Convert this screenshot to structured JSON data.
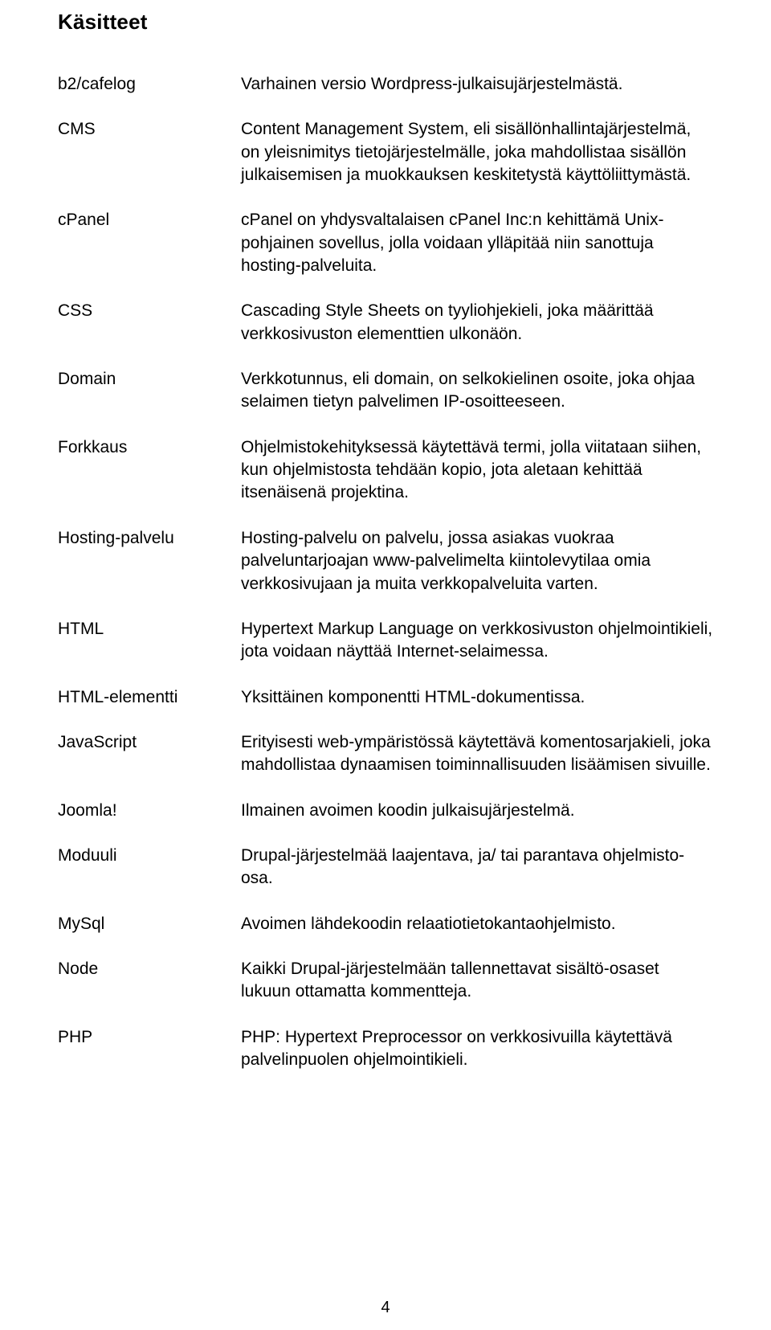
{
  "page": {
    "title": "Käsitteet",
    "number": "4"
  },
  "definitions": [
    {
      "term": "b2/cafelog",
      "def": "Varhainen versio Wordpress-julkaisujärjestelmästä."
    },
    {
      "term": "CMS",
      "def": "Content Management System, eli sisällönhallintajärjestelmä, on yleisnimitys tietojärjestelmälle, joka mahdollistaa sisällön julkaisemisen ja muokkauksen keskitetystä käyttöliittymästä."
    },
    {
      "term": "cPanel",
      "def": "cPanel on yhdysvaltalaisen cPanel Inc:n kehittämä Unix-pohjainen sovellus, jolla voidaan ylläpitää niin sanottuja hosting-palveluita."
    },
    {
      "term": "CSS",
      "def": "Cascading Style Sheets on tyyliohjekieli, joka määrittää verkkosivuston elementtien ulkonäön."
    },
    {
      "term": "Domain",
      "def": "Verkkotunnus, eli domain, on selkokielinen osoite, joka ohjaa selaimen tietyn palvelimen IP-osoitteeseen."
    },
    {
      "term": "Forkkaus",
      "def": "Ohjelmistokehityksessä käytettävä termi, jolla viitataan siihen, kun ohjelmistosta tehdään kopio, jota aletaan kehittää itsenäisenä projektina."
    },
    {
      "term": "Hosting-palvelu",
      "def": "Hosting-palvelu on palvelu, jossa asiakas vuokraa palveluntarjoajan www-palvelimelta kiintolevytilaa omia verkkosivujaan ja muita verkkopalveluita varten."
    },
    {
      "term": "HTML",
      "def": "Hypertext Markup Language on verkkosivuston ohjelmointikieli, jota voidaan näyttää Internet-selaimessa."
    },
    {
      "term": "HTML-elementti",
      "def": "Yksittäinen komponentti HTML-dokumentissa."
    },
    {
      "term": "JavaScript",
      "def": "Erityisesti web-ympäristössä käytettävä komentosarjakieli, joka mahdollistaa dynaamisen toiminnallisuuden lisäämisen sivuille."
    },
    {
      "term": "Joomla!",
      "def": "Ilmainen avoimen koodin julkaisujärjestelmä."
    },
    {
      "term": "Moduuli",
      "def": "Drupal-järjestelmää laajentava, ja/ tai parantava ohjelmisto-osa."
    },
    {
      "term": "MySql",
      "def": "Avoimen lähdekoodin relaatiotietokantaohjelmisto."
    },
    {
      "term": "Node",
      "def": "Kaikki Drupal-järjestelmään tallennettavat sisältö-osaset lukuun ottamatta kommentteja."
    },
    {
      "term": "PHP",
      "def": "PHP: Hypertext Preprocessor on verkkosivuilla käytettävä palvelinpuolen ohjelmointikieli."
    }
  ]
}
